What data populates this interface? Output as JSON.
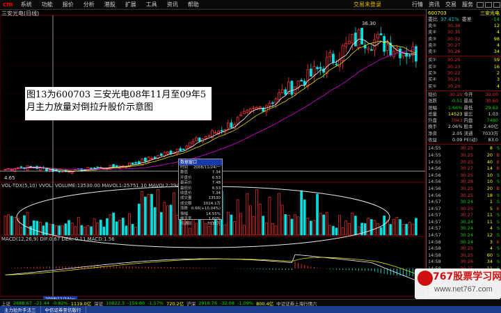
{
  "menubar": {
    "logo": "cm",
    "items": [
      "系统",
      "功能",
      "报价",
      "分析",
      "港股",
      "扩展",
      "工具",
      "资讯",
      "帮助"
    ],
    "center_text": "交易未登录",
    "right_items": [
      "行情",
      "资讯",
      "交易",
      "服务"
    ]
  },
  "chart": {
    "title": "三安光电(日线)",
    "peak_label": "36.30",
    "low_label": "4.65",
    "volume_label": "VOL-TDX(5,10) VVOL: VOLUME:13530.00  MAVOL1:25751.10  MAVOL2:29465.26",
    "macd_label": "MACD(12,26,9) DIF:0.67 DEA:-0.11 MACD:1.56",
    "price_axis": [
      "",
      "",
      "",
      "",
      "",
      "",
      "",
      "",
      ""
    ],
    "annotation": "图13为600703 三安光电08年11月至09年5月主力放量对倒拉升股价示意图",
    "crosshair_date": "2008/11/24/一"
  },
  "popup": {
    "title": "数据窗口",
    "rows": [
      {
        "k": "时间",
        "v": "2008/11/24/一"
      },
      {
        "k": "数值",
        "v": "7.34"
      },
      {
        "k": "开盘价",
        "v": "6.53"
      },
      {
        "k": "最高价",
        "v": "7.48"
      },
      {
        "k": "最低价",
        "v": "6.53"
      },
      {
        "k": "收盘价",
        "v": "7.34"
      },
      {
        "k": "成交量",
        "v": "13530"
      },
      {
        "k": "成交额",
        "v": "1014.1万"
      },
      {
        "k": "涨跌",
        "v": "0.66(+10.04%)"
      },
      {
        "k": "振幅",
        "v": "14.55%"
      },
      {
        "k": "换手率",
        "v": "1.60%"
      },
      {
        "k": "流通股",
        "v": "7033万"
      }
    ]
  },
  "panel": {
    "code": "600703",
    "name": "三安光电",
    "ratio_label": "委比",
    "ratio_value": "37.41%",
    "diff_label": "委差",
    "diff_value": "-14",
    "sells": [
      {
        "k": "卖⑤",
        "p": "30.36",
        "q": "12"
      },
      {
        "k": "卖④",
        "p": "30.35",
        "q": "4"
      },
      {
        "k": "卖③",
        "p": "30.32",
        "q": "98"
      },
      {
        "k": "卖②",
        "p": "30.27",
        "q": "4"
      },
      {
        "k": "卖①",
        "p": "30.26",
        "q": "34"
      }
    ],
    "buys": [
      {
        "k": "买①",
        "p": "30.25",
        "q": "59"
      },
      {
        "k": "买②",
        "p": "30.23",
        "q": "16"
      },
      {
        "k": "买③",
        "p": "30.22",
        "q": "2"
      },
      {
        "k": "买④",
        "p": "30.21",
        "q": "3"
      },
      {
        "k": "买⑤",
        "p": "30.20",
        "q": "4"
      }
    ],
    "stats": [
      {
        "k1": "现价",
        "v1": "30.25",
        "c1": "",
        "k2": "今开",
        "v2": "30.00",
        "c2": ""
      },
      {
        "k1": "涨跌",
        "v1": "-0.51",
        "c1": "g",
        "k2": "最高",
        "v2": "30.60",
        "c2": ""
      },
      {
        "k1": "涨幅",
        "v1": "-1.66%",
        "c1": "g",
        "k2": "最低",
        "v2": "29.63",
        "c2": "g"
      },
      {
        "k1": "总量",
        "v1": "14523",
        "c1": "y",
        "k2": "量比",
        "v2": "1.03",
        "c2": "w"
      },
      {
        "k1": "外盘",
        "v1": "7043",
        "c1": "",
        "k2": "内盘",
        "v2": "7480",
        "c2": "g"
      },
      {
        "k1": "换手",
        "v1": "2.06%",
        "c1": "w",
        "k2": "股本",
        "v2": "2.40亿",
        "c2": "w"
      },
      {
        "k1": "净资",
        "v1": "2.05",
        "c1": "w",
        "k2": "流通",
        "v2": "7033万",
        "c2": "w"
      },
      {
        "k1": "收益",
        "v1": "0.09",
        "c1": "w",
        "k2": "PE(动)",
        "v2": "83.0",
        "c2": "w"
      }
    ],
    "ticks": [
      {
        "t": "14:55",
        "p": "30.25",
        "pc": "",
        "q": "8",
        "s": "S",
        "sc": "g"
      },
      {
        "t": "14:55",
        "p": "30.25",
        "pc": "",
        "q": "20",
        "s": "B",
        "sc": ""
      },
      {
        "t": "14:55",
        "p": "30.25",
        "pc": "",
        "q": "40",
        "s": "B",
        "sc": ""
      },
      {
        "t": "14:56",
        "p": "30.27",
        "pc": "",
        "q": "14",
        "s": "B",
        "sc": ""
      },
      {
        "t": "14:56",
        "p": "30.25",
        "pc": "",
        "q": "10",
        "s": "S",
        "sc": "g"
      },
      {
        "t": "14:56",
        "p": "30.28",
        "pc": "",
        "q": "10",
        "s": "S",
        "sc": "g"
      },
      {
        "t": "14:56",
        "p": "30.25",
        "pc": "",
        "q": "20",
        "s": "B",
        "sc": ""
      },
      {
        "t": "14:56",
        "p": "30.25",
        "pc": "",
        "q": "18",
        "s": "S",
        "sc": "g"
      },
      {
        "t": "14:57",
        "p": "30.24",
        "pc": "g",
        "q": "1",
        "s": "S",
        "sc": "g"
      },
      {
        "t": "14:57",
        "p": "30.25",
        "pc": "",
        "q": "5",
        "s": "B",
        "sc": ""
      },
      {
        "t": "14:57",
        "p": "30.27",
        "pc": "",
        "q": "11",
        "s": "S",
        "sc": "g"
      },
      {
        "t": "14:57",
        "p": "30.24",
        "pc": "g",
        "q": "11",
        "s": "S",
        "sc": "g"
      },
      {
        "t": "14:57",
        "p": "30.24",
        "pc": "g",
        "q": "4",
        "s": "S",
        "sc": "g"
      },
      {
        "t": "14:57",
        "p": "30.24",
        "pc": "g",
        "q": "12",
        "s": "S",
        "sc": "g"
      },
      {
        "t": "14:58",
        "p": "30.24",
        "pc": "g",
        "q": "3",
        "s": "B",
        "sc": ""
      },
      {
        "t": "14:58",
        "p": "30.25",
        "pc": "",
        "q": "4",
        "s": "S",
        "sc": "g"
      },
      {
        "t": "14:58",
        "p": "30.25",
        "pc": "",
        "q": "60",
        "s": "S",
        "sc": "g"
      },
      {
        "t": "14:58",
        "p": "30.26",
        "pc": "",
        "q": "34",
        "s": "S",
        "sc": "g"
      },
      {
        "t": "14:58",
        "p": "30.25",
        "pc": "",
        "q": "11",
        "s": "S",
        "sc": "g"
      },
      {
        "t": "14:58",
        "p": "30.25",
        "pc": "",
        "q": "20",
        "s": "B",
        "sc": ""
      },
      {
        "t": "14:59",
        "p": "30.25",
        "pc": "",
        "q": "4",
        "s": "B",
        "sc": ""
      },
      {
        "t": "14:59",
        "p": "30.25",
        "pc": "",
        "q": "18",
        "s": "S",
        "sc": "g"
      },
      {
        "t": "15:00",
        "p": "30.25",
        "pc": "",
        "q": "50",
        "s": "S",
        "sc": "g"
      },
      {
        "t": "15:00",
        "p": "30.25",
        "pc": "",
        "q": "22",
        "s": "B",
        "sc": ""
      }
    ]
  },
  "statusbar": [
    {
      "t": "上证",
      "c": "st-w"
    },
    {
      "t": "2688.67",
      "c": "st-g"
    },
    {
      "t": "-21.44",
      "c": "st-g"
    },
    {
      "t": "-0.82%",
      "c": "st-g"
    },
    {
      "t": "1119.0亿",
      "c": "st-y"
    },
    {
      "t": "深证",
      "c": "st-w"
    },
    {
      "t": "10822.3",
      "c": "st-g"
    },
    {
      "t": "-159.80",
      "c": "st-g"
    },
    {
      "t": "-1.57%",
      "c": "st-g"
    },
    {
      "t": "720.2亿",
      "c": "st-y"
    },
    {
      "t": "沪深",
      "c": "st-w"
    },
    {
      "t": "2916.76",
      "c": "st-g"
    },
    {
      "t": "-32.08",
      "c": "st-g"
    },
    {
      "t": "-1.09%",
      "c": "st-g"
    },
    {
      "t": "800.4亿",
      "c": "st-y"
    },
    {
      "t": "中证证券上海行情六",
      "c": "st-w"
    }
  ],
  "taskbar": [
    "主力拉升手法三",
    "中信证券至信版行"
  ],
  "watermark": {
    "main": "767股票学习网",
    "sub": "www.net767.com"
  },
  "chart_data": {
    "type": "candlestick",
    "title": "三安光电(日线)",
    "peak": 36.3,
    "low": 4.65,
    "candles_count": 130
  }
}
